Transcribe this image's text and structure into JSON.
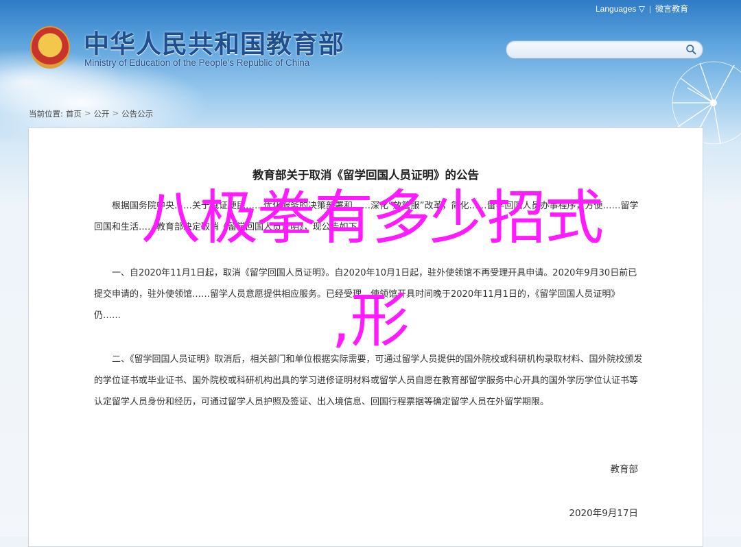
{
  "header": {
    "site_title": "中华人民共和国教育部",
    "site_subtitle": "Ministry of Education of the People's Republic of China",
    "top_links": {
      "languages": "Languages ▽",
      "weibo": "微言教育"
    },
    "search": {
      "placeholder": ""
    }
  },
  "breadcrumb": {
    "prefix": "当前位置:",
    "items": [
      "首页",
      "公开",
      "公告公示"
    ]
  },
  "document": {
    "title": "教育部关于取消《留学回国人员证明》的公告",
    "paragraphs": [
      "根据国务院中央……关于减证便民……优化服务的决策部署和……深化“放管服”改革，简化……留学回国人员办事程序，方便……留学回国和生活……教育部决定取消《留学回国人员证明》，现公告如下：",
      "一、自2020年11月1日起，取消《留学回国人员证明》。自2020年10月1日起，驻外使领馆不再受理开具申请。2020年9月30日前已提交申请的，驻外使领馆……留学人员意愿提供相应服务。已经受理、使领馆开具时间晚于2020年11月1日的，《留学回国人员证明》仍……",
      "二、《留学回国人员证明》取消后，相关部门和单位根据实际需要，可通过留学人员提供的国外院校或科研机构录取材料、国外院校颁发的学位证书或毕业证书、国外院校或科研机构出具的学习进修证明材料或留学人员自愿在教育部留学服务中心开具的国外学历学位认证书等认定留学人员身份和经历，可通过留学人员护照及签证、出入境信息、回国行程票据等确定留学人员在外留学期限。"
    ],
    "signature": "教育部",
    "date": "2020年9月17日"
  },
  "overlay": {
    "line1": "八极拳有多少招式",
    "line2": ",形"
  },
  "colors": {
    "title_blue": "#1f4f8f",
    "overlay_magenta": "#ff1aff"
  }
}
